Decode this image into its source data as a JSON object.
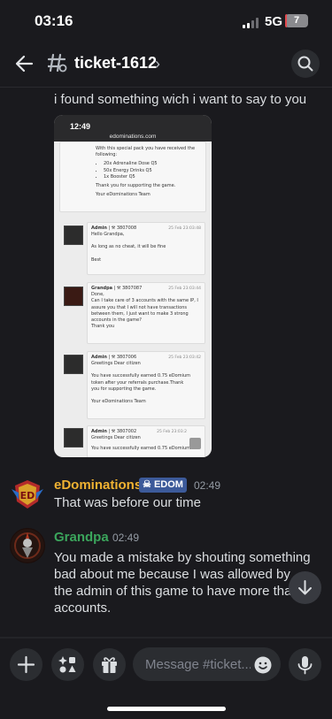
{
  "status_bar": {
    "time": "03:16",
    "network": "5G",
    "battery": "7",
    "battery_level": 0.07
  },
  "header": {
    "channel": "ticket-1612",
    "chevron": "›",
    "icons": [
      "back-arrow-icon",
      "threads-icon",
      "search-icon"
    ]
  },
  "intro_message": {
    "text": "i found something wich i want to say to you"
  },
  "attachment": {
    "phone_time": "12:49",
    "url": "edominations.com",
    "top_lines": [
      "With this special pack you have received the",
      "following:"
    ],
    "items": [
      "20x Adrenaline Dose Q5",
      "50x Energy Drinks Q5",
      "1x Booster Q5"
    ],
    "thanks": "Thank you for supporting the game.",
    "team": "Your eDominations Team",
    "posts": [
      {
        "user": "Admin",
        "meta": "| ⚒ 3807008",
        "date": "25 Feb 23:03:48",
        "lines": [
          "Hello Grandpa,",
          "",
          "As long as no cheat, it will be fine",
          "",
          "Best"
        ]
      },
      {
        "user": "Grandpa",
        "meta": "| ⚒ 3807087",
        "date": "25 Feb 23:03:44",
        "lines": [
          "Done,",
          "Can I take care of 3 accounts with the same IP, I",
          "assure you that I will not have transactions",
          "between them, I just want to make 3 strong",
          "accounts in the game?",
          "Thank you"
        ]
      },
      {
        "user": "Admin",
        "meta": "| ⚒ 3807006",
        "date": "25 Feb 23:03:42",
        "lines": [
          "Greetings Dear citizen",
          "",
          "You have successfully earned 0.75 eDomium",
          "token after your referrals purchase.Thank",
          "you for supporting the game.",
          "",
          "Your eDominations Team"
        ]
      },
      {
        "user": "Admin",
        "meta": "| ⚒ 3807002",
        "date": "25 Feb 23:03:2",
        "lines": [
          "Greetings Dear citizen",
          "You have successfully earned 0.75 eDomium"
        ]
      }
    ]
  },
  "messages": [
    {
      "username": "eDominations",
      "badge": "EDOM",
      "badge_icon": "skull-icon",
      "time": "02:49",
      "text": "That was before our time",
      "name_color": "#f0b232"
    },
    {
      "username": "Grandpa",
      "time": "02:49",
      "text": "You made a mistake by shouting something bad about me because I was allowed by the admin of this game to have more than 2 accounts.",
      "name_color": "#3ba55c"
    }
  ],
  "composer": {
    "placeholder": "Message #ticket...",
    "icons": [
      "plus-icon",
      "apps-icon",
      "gift-icon",
      "emoji-icon",
      "microphone-icon"
    ]
  },
  "colors": {
    "background": "#1a1a1e",
    "username_edom": "#f0b232",
    "username_grandpa": "#3ba55c",
    "badge": "#3c5a9a"
  }
}
